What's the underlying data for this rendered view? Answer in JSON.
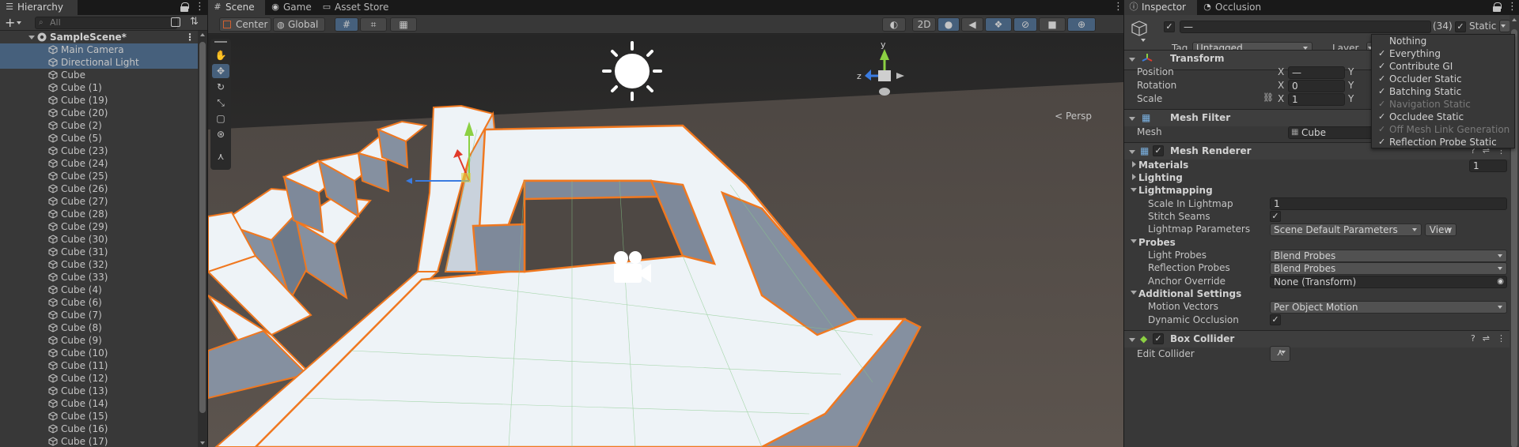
{
  "hierarchy": {
    "tab_label": "Hierarchy",
    "search_placeholder": "All",
    "scene_name": "SampleScene*",
    "items": [
      "Main Camera",
      "Directional Light",
      "Cube",
      "Cube (1)",
      "Cube (19)",
      "Cube (20)",
      "Cube (2)",
      "Cube (5)",
      "Cube (23)",
      "Cube (24)",
      "Cube (25)",
      "Cube (26)",
      "Cube (27)",
      "Cube (28)",
      "Cube (29)",
      "Cube (30)",
      "Cube (31)",
      "Cube (32)",
      "Cube (33)",
      "Cube (4)",
      "Cube (6)",
      "Cube (7)",
      "Cube (8)",
      "Cube (9)",
      "Cube (10)",
      "Cube (11)",
      "Cube (12)",
      "Cube (13)",
      "Cube (14)",
      "Cube (15)",
      "Cube (16)",
      "Cube (17)"
    ]
  },
  "scene": {
    "tabs": [
      "Scene",
      "Game",
      "Asset Store"
    ],
    "pivot_label": "Center",
    "space_label": "Global",
    "mode_2d": "2D",
    "persp_label": "Persp",
    "gizmo_axes": {
      "y": "y",
      "z": "z"
    }
  },
  "inspector": {
    "tabs": [
      "Inspector",
      "Occlusion"
    ],
    "object_name": "—",
    "layer_count": "(34)",
    "static_label": "Static",
    "tag_label": "Tag",
    "tag_value": "Untagged",
    "layer_label": "Layer",
    "transform": {
      "title": "Transform",
      "position_label": "Position",
      "rotation_label": "Rotation",
      "scale_label": "Scale",
      "position_x": "—",
      "rotation_x": "0",
      "scale_x": "1",
      "x_label": "X",
      "y_label": "Y"
    },
    "mesh_filter": {
      "title": "Mesh Filter",
      "mesh_label": "Mesh",
      "mesh_value": "Cube"
    },
    "mesh_renderer": {
      "title": "Mesh Renderer",
      "materials_label": "Materials",
      "materials_count": "1",
      "lighting_label": "Lighting",
      "lightmapping_label": "Lightmapping",
      "scale_in_lightmap_label": "Scale In Lightmap",
      "scale_in_lightmap_value": "1",
      "stitch_seams_label": "Stitch Seams",
      "lightmap_params_label": "Lightmap Parameters",
      "lightmap_params_value": "Scene Default Parameters",
      "view_button": "View",
      "probes_label": "Probes",
      "light_probes_label": "Light Probes",
      "light_probes_value": "Blend Probes",
      "reflection_probes_label": "Reflection Probes",
      "reflection_probes_value": "Blend Probes",
      "anchor_override_label": "Anchor Override",
      "anchor_override_value": "None (Transform)",
      "additional_label": "Additional Settings",
      "motion_vectors_label": "Motion Vectors",
      "motion_vectors_value": "Per Object Motion",
      "dynamic_occlusion_label": "Dynamic Occlusion"
    },
    "box_collider": {
      "title": "Box Collider",
      "edit_collider_label": "Edit Collider"
    },
    "static_menu": [
      {
        "label": "Nothing",
        "checked": false,
        "enabled": true
      },
      {
        "label": "Everything",
        "checked": true,
        "enabled": true
      },
      {
        "label": "Contribute GI",
        "checked": true,
        "enabled": true
      },
      {
        "label": "Occluder Static",
        "checked": true,
        "enabled": true
      },
      {
        "label": "Batching Static",
        "checked": true,
        "enabled": true
      },
      {
        "label": "Navigation Static",
        "checked": true,
        "enabled": false
      },
      {
        "label": "Occludee Static",
        "checked": true,
        "enabled": true
      },
      {
        "label": "Off Mesh Link Generation",
        "checked": true,
        "enabled": false
      },
      {
        "label": "Reflection Probe Static",
        "checked": true,
        "enabled": true
      }
    ]
  }
}
